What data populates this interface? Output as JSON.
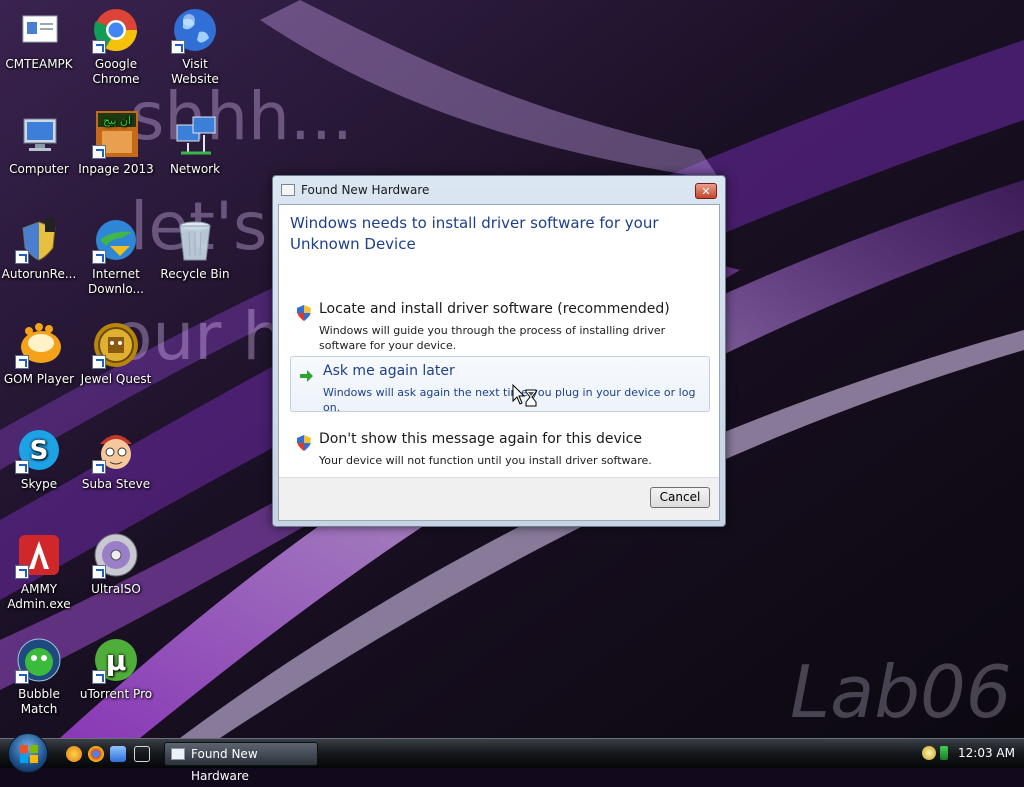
{
  "desktop": {
    "wallpaper_text": [
      "shhh...",
      "let's",
      "our h"
    ],
    "watermark": "Lab06",
    "icons": [
      {
        "label": "CMTEAMPK",
        "icon": "contact-card-icon"
      },
      {
        "label": "Google\nChrome",
        "icon": "chrome-icon"
      },
      {
        "label": "Visit Website",
        "icon": "globe-icon"
      },
      {
        "label": "Computer",
        "icon": "computer-icon"
      },
      {
        "label": "Inpage 2013",
        "icon": "inpage-icon"
      },
      {
        "label": "Network",
        "icon": "network-icon"
      },
      {
        "label": "AutorunRe...",
        "icon": "shield-usb-icon"
      },
      {
        "label": "Internet\nDownlo...",
        "icon": "idm-icon"
      },
      {
        "label": "Recycle Bin",
        "icon": "recycle-bin-icon"
      },
      {
        "label": "GOM Player",
        "icon": "gom-player-icon"
      },
      {
        "label": "Jewel Quest",
        "icon": "jewel-quest-icon"
      },
      {
        "label": "Skype",
        "icon": "skype-icon"
      },
      {
        "label": "Suba Steve",
        "icon": "suba-steve-icon"
      },
      {
        "label": "AMMY\nAdmin.exe",
        "icon": "ammy-admin-icon"
      },
      {
        "label": "UltraISO",
        "icon": "ultraiso-icon"
      },
      {
        "label": "Bubble Match",
        "icon": "bubble-match-icon"
      },
      {
        "label": "uTorrent Pro",
        "icon": "utorrent-icon"
      }
    ]
  },
  "dialog": {
    "title": "Found New Hardware",
    "close_label": "✕",
    "heading": "Windows needs to install driver software for your Unknown Device",
    "options": [
      {
        "title": "Locate and install driver software (recommended)",
        "desc": "Windows will guide you through the process of installing driver software for your device.",
        "icon": "uac-shield-icon"
      },
      {
        "title": "Ask me again later",
        "desc": "Windows will ask again the next time you plug in your device or log on.",
        "icon": "green-arrow-icon"
      },
      {
        "title": "Don't show this message again for this device",
        "desc": "Your device will not function until you install driver software.",
        "icon": "uac-shield-icon"
      }
    ],
    "cancel_label": "Cancel"
  },
  "taskbar": {
    "task_button_label": "Found New Hardware",
    "clock": "12:03 AM"
  },
  "colors": {
    "heading_blue": "#1e3f8a",
    "wallpaper_purple": "#9b3fd6"
  }
}
